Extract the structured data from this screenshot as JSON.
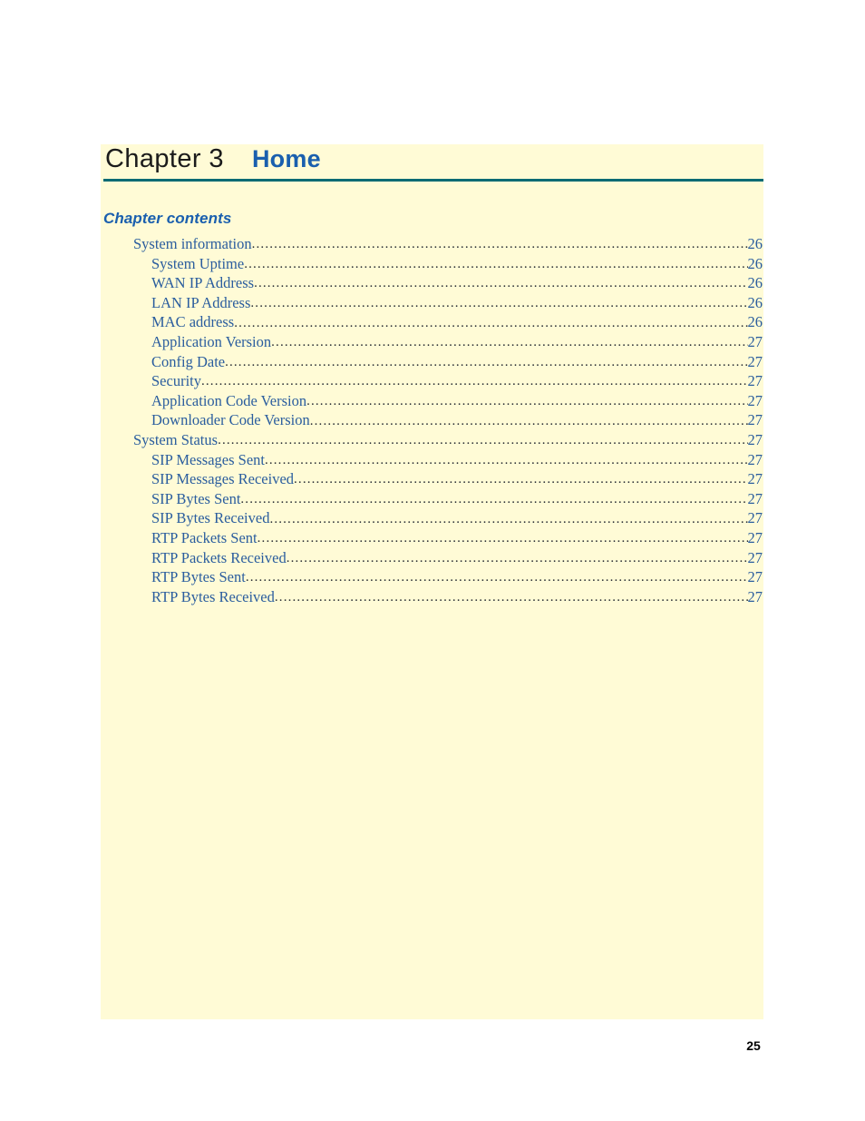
{
  "page": {
    "number": "25",
    "background_color": "#ffffff",
    "panel_color": "#fffbd6",
    "accent_blue": "#1a5fae",
    "rule_color": "#0b6b74",
    "toc_text_color": "#2a5d9e"
  },
  "chapter": {
    "number_label": "Chapter 3",
    "title": "Home"
  },
  "contents": {
    "heading": "Chapter contents",
    "entries": [
      {
        "label": "System information",
        "page": "26",
        "level": 1,
        "leader_gap": false
      },
      {
        "label": "System Uptime",
        "page": "26",
        "level": 2,
        "leader_gap": true
      },
      {
        "label": "WAN IP Address",
        "page": "26",
        "level": 2,
        "leader_gap": true
      },
      {
        "label": "LAN IP Address",
        "page": "26",
        "level": 2,
        "leader_gap": true
      },
      {
        "label": "MAC address",
        "page": "26",
        "level": 2,
        "leader_gap": true
      },
      {
        "label": "Application Version",
        "page": "27",
        "level": 2,
        "leader_gap": true
      },
      {
        "label": "Config Date",
        "page": "27",
        "level": 2,
        "leader_gap": true
      },
      {
        "label": "Security",
        "page": "27",
        "level": 2,
        "leader_gap": true
      },
      {
        "label": "Application Code Version",
        "page": "27",
        "level": 2,
        "leader_gap": true
      },
      {
        "label": "Downloader Code Version",
        "page": "27",
        "level": 2,
        "leader_gap": true
      },
      {
        "label": "System Status",
        "page": "27",
        "level": 1,
        "leader_gap": false
      },
      {
        "label": "SIP Messages Sent",
        "page": "27",
        "level": 2,
        "leader_gap": true
      },
      {
        "label": "SIP Messages Received",
        "page": "27",
        "level": 2,
        "leader_gap": true
      },
      {
        "label": "SIP Bytes Sent",
        "page": "27",
        "level": 2,
        "leader_gap": true
      },
      {
        "label": "SIP Bytes Received",
        "page": "27",
        "level": 2,
        "leader_gap": true
      },
      {
        "label": "RTP Packets Sent",
        "page": "27",
        "level": 2,
        "leader_gap": true
      },
      {
        "label": "RTP Packets Received",
        "page": "27",
        "level": 2,
        "leader_gap": true
      },
      {
        "label": "RTP Bytes Sent",
        "page": "27",
        "level": 2,
        "leader_gap": true
      },
      {
        "label": "RTP Bytes Received",
        "page": "27",
        "level": 2,
        "leader_gap": true
      }
    ]
  }
}
